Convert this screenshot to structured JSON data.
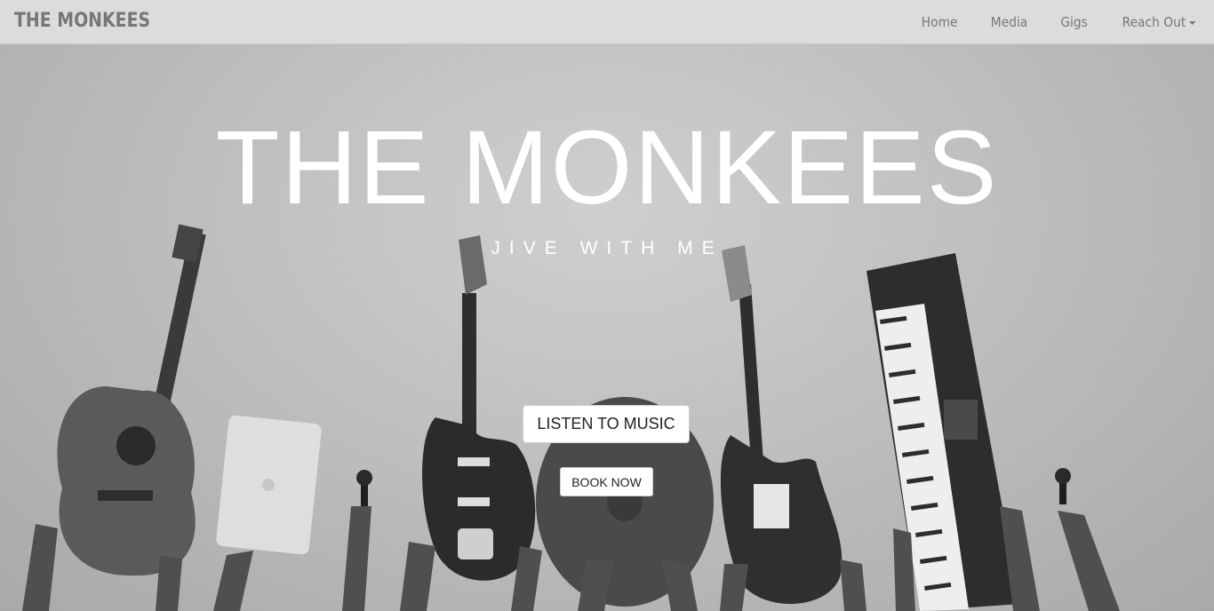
{
  "navbar": {
    "brand": "THE MONKEES",
    "items": [
      {
        "label": "Home"
      },
      {
        "label": "Media"
      },
      {
        "label": "Gigs"
      },
      {
        "label": "Reach Out"
      }
    ]
  },
  "hero": {
    "title": "THE MONKEES",
    "subtitle": "JIVE WITH ME",
    "primary_button": "LISTEN TO MUSIC",
    "secondary_button": "BOOK NOW"
  },
  "colors": {
    "navbar_bg": "#dcdcdc",
    "nav_text": "#777777",
    "hero_text": "#ffffff",
    "button_bg": "#ffffff"
  },
  "icons": [
    "caret-down-icon"
  ]
}
